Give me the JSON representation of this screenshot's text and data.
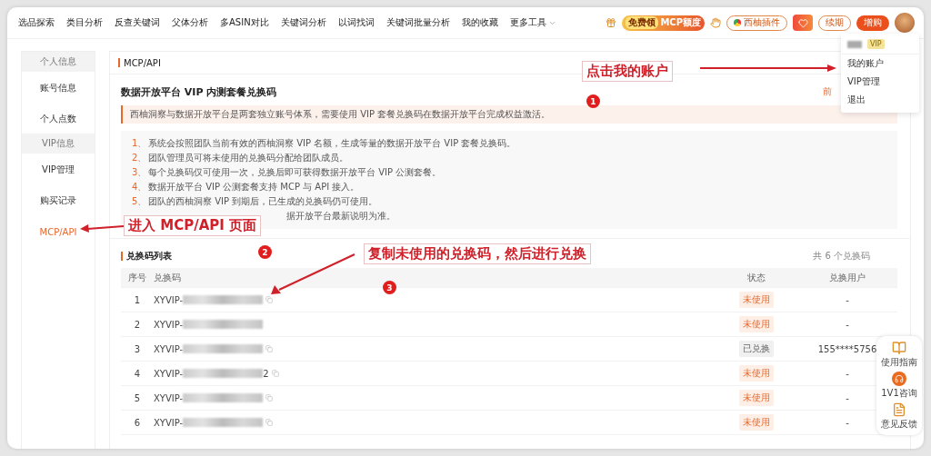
{
  "nav": {
    "items": [
      "选品探索",
      "类目分析",
      "反查关键词",
      "父体分析",
      "多ASIN对比",
      "关键词分析",
      "以词找词",
      "关键词批量分析",
      "我的收藏"
    ],
    "more": "更多工具"
  },
  "header_actions": {
    "promo_tag": "免费领",
    "promo_label": "MCP额度",
    "plugin": "西柚插件",
    "renew": "续期",
    "upgrade": "增购"
  },
  "account_menu": {
    "vip_tag": "VIP",
    "items": [
      "我的账户",
      "VIP管理",
      "退出"
    ]
  },
  "sidebar": [
    {
      "kind": "group",
      "label": "个人信息",
      "selected": false
    },
    {
      "kind": "item",
      "label": "账号信息",
      "selected": false
    },
    {
      "kind": "item",
      "label": "个人点数",
      "selected": false
    },
    {
      "kind": "group",
      "label": "VIP信息",
      "selected": false
    },
    {
      "kind": "item",
      "label": "VIP管理",
      "selected": false
    },
    {
      "kind": "item",
      "label": "购买记录",
      "selected": false
    },
    {
      "kind": "item",
      "label": "MCP/API",
      "selected": true
    }
  ],
  "page": {
    "section_title": "MCP/API",
    "title": "数据开放平台 VIP 内测套餐兑换码",
    "title_link": "前",
    "notice": "西柚洞察与数据开放平台是两套独立账号体系，需要使用 VIP 套餐兑换码在数据开放平台完成权益激活。",
    "rules": [
      {
        "number": "1、",
        "text": "系统会按照团队当前有效的西柚洞察 VIP 名额，生成等量的数据开放平台 VIP 套餐兑换码。"
      },
      {
        "number": "2、",
        "text": "团队管理员可将未使用的兑换码分配给团队成员。"
      },
      {
        "number": "3、",
        "text": "每个兑换码仅可使用一次，兑换后即可获得数据开放平台 VIP 公测套餐。"
      },
      {
        "number": "4、",
        "text": "数据开放平台 VIP 公测套餐支持 MCP 与 API 接入。"
      },
      {
        "number": "5、",
        "text": "团队的西柚洞察 VIP 到期后，已生成的兑换码仍可使用。"
      },
      {
        "text": "据开放平台最新说明为准。"
      }
    ]
  },
  "codes": {
    "title": "兑换码列表",
    "count": "共 6 个兑换码",
    "columns": [
      "序号",
      "兑换码",
      "状态",
      "兑换用户"
    ],
    "rows": [
      {
        "index": "1",
        "code": "XYVIP-",
        "copy_icon": true,
        "status": "未使用",
        "kind": "unused",
        "user": "-"
      },
      {
        "index": "2",
        "code": "XYVIP-",
        "copy_icon": false,
        "status": "未使用",
        "kind": "unused",
        "user": "-"
      },
      {
        "index": "3",
        "code": "XYVIP-",
        "copy_icon": true,
        "status": "已兑换",
        "kind": "redeemed",
        "user": "155****5756"
      },
      {
        "index": "4",
        "code": "XYVIP-",
        "suffix": "2",
        "copy_icon": true,
        "status": "未使用",
        "kind": "unused",
        "user": "-"
      },
      {
        "index": "5",
        "code": "XYVIP-",
        "copy_icon": true,
        "status": "未使用",
        "kind": "unused",
        "user": "-"
      },
      {
        "index": "6",
        "code": "XYVIP-",
        "copy_icon": true,
        "status": "未使用",
        "kind": "unused",
        "user": "-"
      }
    ]
  },
  "float_tools": [
    {
      "kind": "guide",
      "label": "使用指南"
    },
    {
      "kind": "chat",
      "label": "1V1咨询"
    },
    {
      "kind": "feedback",
      "label": "意见反馈"
    }
  ],
  "annotations": [
    {
      "number": "1",
      "text": "点击我的账户"
    },
    {
      "number": "2",
      "text": "进入 MCP/API 页面"
    },
    {
      "number": "3",
      "text": "复制未使用的兑换码，然后进行兑换"
    }
  ]
}
